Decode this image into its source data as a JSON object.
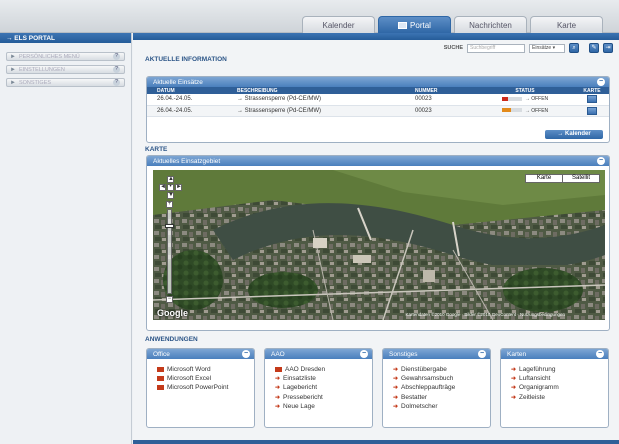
{
  "tabs": [
    {
      "label": "Kalender",
      "active": false
    },
    {
      "label": "Portal",
      "active": true
    },
    {
      "label": "Nachrichten",
      "active": false
    },
    {
      "label": "Karte",
      "active": false
    }
  ],
  "sidebar": {
    "title": "→ ELS PORTAL",
    "items": [
      {
        "label": "PERSÖNLICHES MENÜ",
        "help": "?"
      },
      {
        "label": "EINSTELLUNGEN",
        "help": "?"
      },
      {
        "label": "SONSTIGES",
        "help": "?"
      }
    ]
  },
  "search": {
    "label": "SUCHE",
    "placeholder": "Suchbegriff",
    "scope": "Einsätze ▾"
  },
  "info": {
    "section_title": "AKTUELLE INFORMATION",
    "panel_title": "Aktuelle Einsätze",
    "columns": [
      "DATUM",
      "BESCHREIBUNG",
      "NUMMER",
      "STATUS",
      "KARTE"
    ],
    "rows": [
      {
        "datum": "26.04.-24.05.",
        "beschreibung": "→ Strassensperre (Pd-CE/MW)",
        "nummer": "00023",
        "status": "→ OFFEN",
        "progress": 0.3
      },
      {
        "datum": "26.04.-24.05.",
        "beschreibung": "→ Strassensperre (Pd-CE/MW)",
        "nummer": "00023",
        "status": "→ OFFEN",
        "progress": 0.45
      }
    ],
    "calendar_button": "→ Kalender"
  },
  "map": {
    "section_title": "KARTE",
    "panel_title": "Aktuelles Einsatzgebiet",
    "type_map": "Karte",
    "type_satellite": "Satellit",
    "logo": "Google",
    "copyright": "Kartendaten ©2010 Google · Bilder ©2010 GeoContent · Nutzungsbedingungen"
  },
  "apps": {
    "section_title": "ANWENDUNGEN",
    "panels": [
      {
        "title": "Office",
        "icon": "office-icon",
        "items": [
          "Microsoft Word",
          "Microsoft Excel",
          "Microsoft PowerPoint"
        ]
      },
      {
        "title": "AAO",
        "icon": "arrow-icon",
        "items": [
          "AAO Dresden",
          "Einsatzliste",
          "Lagebericht",
          "Pressebericht",
          "Neue Lage"
        ]
      },
      {
        "title": "Sonstiges",
        "icon": "arrow-icon",
        "items": [
          "Dienstübergabe",
          "Gewahrsamsbuch",
          "Abschleppaufträge",
          "Bestatter",
          "Dolmetscher"
        ]
      },
      {
        "title": "Karten",
        "icon": "arrow-icon",
        "items": [
          "Lageführung",
          "Luftansicht",
          "Organigramm",
          "Zeitleiste"
        ]
      }
    ]
  },
  "colors": {
    "accent": "#2f67a6",
    "header": "#4a7fbd",
    "status_red": "#cc2a1a",
    "status_orange": "#e38a1a"
  }
}
